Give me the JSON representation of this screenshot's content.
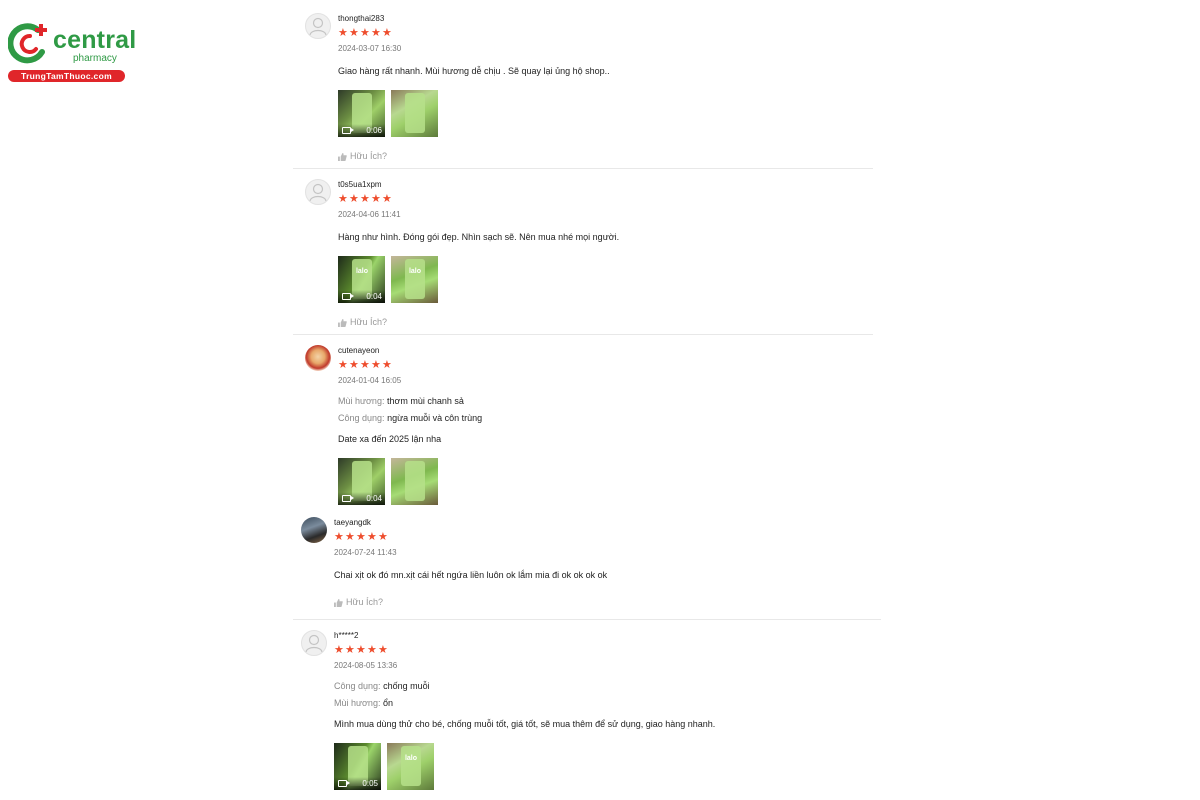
{
  "brand": {
    "name": "central",
    "sub": "pharmacy",
    "site": "TrungTamThuoc.com",
    "colors": {
      "green": "#2f9a45",
      "red": "#e0262a"
    }
  },
  "star_color": "#ee4d2d",
  "reviews": [
    {
      "username": "thongthai283",
      "rating": 5,
      "date": "2024-03-07 16:30",
      "attributes": [],
      "comment": "Giao hàng rất nhanh.  Mùi hương dễ chịu . Sẽ quay lại ủng hộ shop..",
      "media": [
        {
          "type": "video",
          "duration": "0:06"
        },
        {
          "type": "image"
        }
      ],
      "helpful": "Hữu Ích?"
    },
    {
      "username": "t0s5ua1xpm",
      "rating": 5,
      "date": "2024-04-06 11:41",
      "attributes": [],
      "comment": "Hàng như hình. Đóng gói đẹp. Nhìn sạch sẽ. Nên mua nhé mọi người.",
      "media": [
        {
          "type": "video",
          "duration": "0:04"
        },
        {
          "type": "image"
        }
      ],
      "helpful": "Hữu Ích?"
    },
    {
      "username": "cutenayeon",
      "rating": 5,
      "date": "2024-01-04 16:05",
      "attributes": [
        {
          "key": "Mùi hương:",
          "value": "thơm mùi chanh sả"
        },
        {
          "key": "Công dụng:",
          "value": "ngừa muỗi và côn trùng"
        }
      ],
      "comment": "Date xa đến 2025 lận nha",
      "media": [
        {
          "type": "video",
          "duration": "0:04"
        },
        {
          "type": "image"
        }
      ],
      "helpful": ""
    },
    {
      "username": "taeyangdk",
      "rating": 5,
      "date": "2024-07-24 11:43",
      "attributes": [],
      "comment": "Chai xịt ok đó mn.xịt cái hết ngứa liền luôn ok lắm mia đi ok ok ok ok",
      "media": [],
      "helpful": "Hữu Ích?"
    },
    {
      "username": "h*****2",
      "rating": 5,
      "date": "2024-08-05 13:36",
      "attributes": [
        {
          "key": "Công dụng:",
          "value": "chống muỗi"
        },
        {
          "key": "Mùi hương:",
          "value": "ổn"
        }
      ],
      "comment": "Mình mua dùng thử cho bé, chống muỗi tốt, giá tốt, sẽ mua thêm để sử dụng, giao hàng nhanh.",
      "media": [
        {
          "type": "video",
          "duration": "0:05"
        },
        {
          "type": "image"
        }
      ],
      "helpful": ""
    }
  ]
}
